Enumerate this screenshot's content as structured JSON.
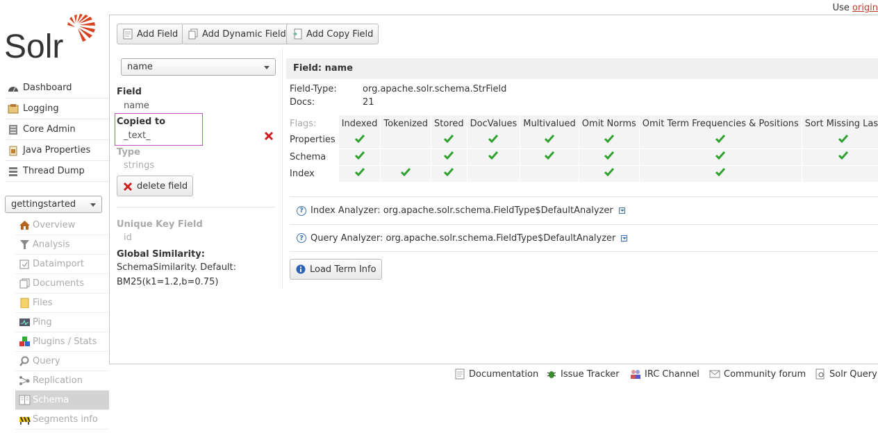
{
  "topbar": {
    "prefix": "Use ",
    "link": "origin"
  },
  "brand": {
    "name": "Solr",
    "accent": "#d9411e"
  },
  "nav": [
    {
      "label": "Dashboard",
      "icon": "dashboard-icon"
    },
    {
      "label": "Logging",
      "icon": "logging-icon"
    },
    {
      "label": "Core Admin",
      "icon": "core-admin-icon"
    },
    {
      "label": "Java Properties",
      "icon": "java-icon"
    },
    {
      "label": "Thread Dump",
      "icon": "thread-dump-icon"
    }
  ],
  "core_selector": {
    "value": "gettingstarted"
  },
  "core_menu": [
    {
      "label": "Overview",
      "icon": "home-icon"
    },
    {
      "label": "Analysis",
      "icon": "funnel-icon"
    },
    {
      "label": "Dataimport",
      "icon": "dataimport-icon"
    },
    {
      "label": "Documents",
      "icon": "documents-icon"
    },
    {
      "label": "Files",
      "icon": "files-icon"
    },
    {
      "label": "Ping",
      "icon": "ping-icon"
    },
    {
      "label": "Plugins / Stats",
      "icon": "plugins-icon"
    },
    {
      "label": "Query",
      "icon": "query-icon"
    },
    {
      "label": "Replication",
      "icon": "replication-icon"
    },
    {
      "label": "Schema",
      "icon": "schema-icon"
    },
    {
      "label": "Segments info",
      "icon": "segments-icon"
    }
  ],
  "toolbar": {
    "add_field": "Add Field",
    "add_dynamic_field": "Add Dynamic Field",
    "add_copy_field": "Add Copy Field"
  },
  "field_select": {
    "value": "name"
  },
  "left": {
    "field_label": "Field",
    "field_value": "name",
    "copied_label": "Copied to",
    "copied_value": "_text_",
    "type_label": "Type",
    "type_value": "strings",
    "delete_label": "delete field",
    "unique_label": "Unique Key Field",
    "unique_value": "id",
    "similarity_label": "Global Similarity:",
    "similarity_line1": "SchemaSimilarity. Default:",
    "similarity_line2": "BM25(k1=1.2,b=0.75)"
  },
  "detail": {
    "header": "Field: name",
    "field_type_label": "Field-Type:",
    "field_type_value": "org.apache.solr.schema.StrField",
    "docs_label": "Docs:",
    "docs_value": "21",
    "flags_label": "Flags:",
    "columns": [
      "Indexed",
      "Tokenized",
      "Stored",
      "DocValues",
      "Multivalued",
      "Omit Norms",
      "Omit Term Frequencies & Positions",
      "Sort Missing Last"
    ],
    "rows": [
      {
        "label": "Properties",
        "checks": [
          true,
          false,
          true,
          true,
          true,
          true,
          true,
          true
        ]
      },
      {
        "label": "Schema",
        "checks": [
          true,
          false,
          true,
          true,
          true,
          true,
          true,
          true
        ]
      },
      {
        "label": "Index",
        "checks": [
          true,
          true,
          true,
          false,
          false,
          true,
          true,
          false
        ]
      }
    ],
    "index_analyzer": "Index Analyzer: org.apache.solr.schema.FieldType$DefaultAnalyzer",
    "query_analyzer": "Query Analyzer: org.apache.solr.schema.FieldType$DefaultAnalyzer",
    "load_term_info": "Load Term Info"
  },
  "footer": {
    "documentation": "Documentation",
    "issue_tracker": "Issue Tracker",
    "irc_channel": "IRC Channel",
    "community_forum": "Community forum",
    "query_syntax": "Solr Query S"
  },
  "colors": {
    "check": "#2ea12e",
    "delete": "#cc1f1f",
    "highlight_border": "#c54ec5"
  }
}
